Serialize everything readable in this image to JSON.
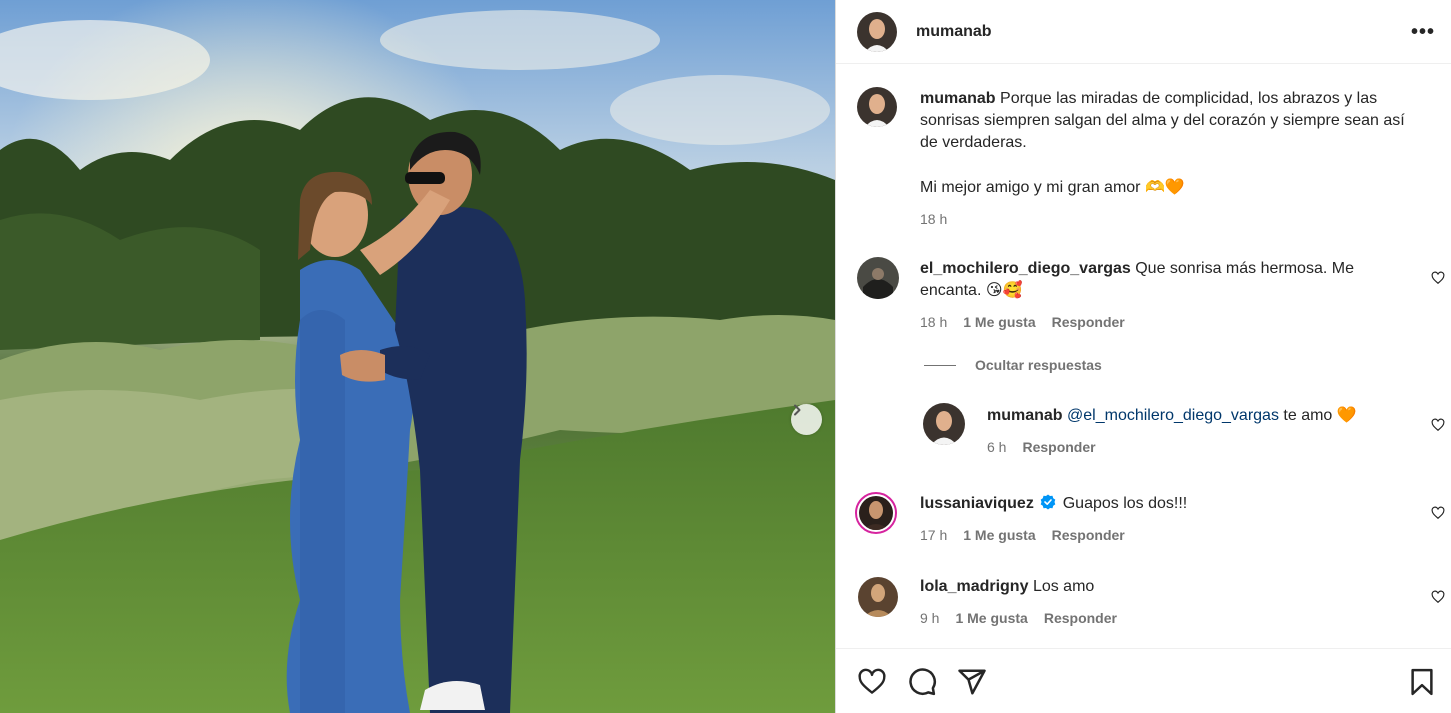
{
  "post": {
    "photo_alt": "",
    "next_icon": "chevron-right-icon"
  },
  "header": {
    "username": "mumanab",
    "more_icon": "more-horizontal-icon",
    "more_glyph": "•••"
  },
  "caption": {
    "username": "mumanab",
    "text": "Porque las miradas de complicidad, los abrazos y las sonrisas siempren salgan del alma y del corazón y siempre sean así de verdaderas.",
    "text2": "Mi mejor amigo y mi gran amor 🫶🧡",
    "time": "18 h"
  },
  "comments": [
    {
      "username": "el_mochilero_diego_vargas",
      "text": "Que sonrisa más hermosa. Me encanta. 😘🥰",
      "time": "18 h",
      "likes": "1 Me gusta",
      "reply": "Responder"
    },
    {
      "username": "lussaniaviquez",
      "verified": true,
      "text": "Guapos los dos!!!",
      "time": "17 h",
      "likes": "1 Me gusta",
      "reply": "Responder"
    },
    {
      "username": "lola_madrigny",
      "text": "Los amo",
      "time": "9 h",
      "likes": "1 Me gusta",
      "reply": "Responder"
    }
  ],
  "replies_toggle": "Ocultar respuestas",
  "reply": {
    "username": "mumanab",
    "mention": "@el_mochilero_diego_vargas",
    "text": "te amo 🧡",
    "time": "6 h",
    "reply": "Responder"
  },
  "actions": {
    "like_icon": "heart-icon",
    "comment_icon": "comment-icon",
    "share_icon": "share-icon",
    "save_icon": "bookmark-icon"
  },
  "colors": {
    "text": "#262626",
    "secondary": "#737373",
    "mention": "#00376b",
    "verified": "#0095f6",
    "story_ring": "#d6249f"
  }
}
